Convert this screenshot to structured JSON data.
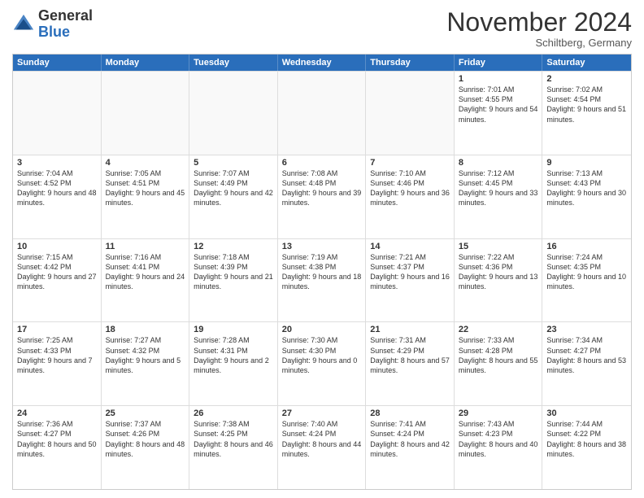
{
  "header": {
    "logo_general": "General",
    "logo_blue": "Blue",
    "month_title": "November 2024",
    "location": "Schiltberg, Germany"
  },
  "calendar": {
    "weekdays": [
      "Sunday",
      "Monday",
      "Tuesday",
      "Wednesday",
      "Thursday",
      "Friday",
      "Saturday"
    ],
    "rows": [
      [
        {
          "day": "",
          "info": "",
          "empty": true
        },
        {
          "day": "",
          "info": "",
          "empty": true
        },
        {
          "day": "",
          "info": "",
          "empty": true
        },
        {
          "day": "",
          "info": "",
          "empty": true
        },
        {
          "day": "",
          "info": "",
          "empty": true
        },
        {
          "day": "1",
          "info": "Sunrise: 7:01 AM\nSunset: 4:55 PM\nDaylight: 9 hours\nand 54 minutes."
        },
        {
          "day": "2",
          "info": "Sunrise: 7:02 AM\nSunset: 4:54 PM\nDaylight: 9 hours\nand 51 minutes."
        }
      ],
      [
        {
          "day": "3",
          "info": "Sunrise: 7:04 AM\nSunset: 4:52 PM\nDaylight: 9 hours\nand 48 minutes."
        },
        {
          "day": "4",
          "info": "Sunrise: 7:05 AM\nSunset: 4:51 PM\nDaylight: 9 hours\nand 45 minutes."
        },
        {
          "day": "5",
          "info": "Sunrise: 7:07 AM\nSunset: 4:49 PM\nDaylight: 9 hours\nand 42 minutes."
        },
        {
          "day": "6",
          "info": "Sunrise: 7:08 AM\nSunset: 4:48 PM\nDaylight: 9 hours\nand 39 minutes."
        },
        {
          "day": "7",
          "info": "Sunrise: 7:10 AM\nSunset: 4:46 PM\nDaylight: 9 hours\nand 36 minutes."
        },
        {
          "day": "8",
          "info": "Sunrise: 7:12 AM\nSunset: 4:45 PM\nDaylight: 9 hours\nand 33 minutes."
        },
        {
          "day": "9",
          "info": "Sunrise: 7:13 AM\nSunset: 4:43 PM\nDaylight: 9 hours\nand 30 minutes."
        }
      ],
      [
        {
          "day": "10",
          "info": "Sunrise: 7:15 AM\nSunset: 4:42 PM\nDaylight: 9 hours\nand 27 minutes."
        },
        {
          "day": "11",
          "info": "Sunrise: 7:16 AM\nSunset: 4:41 PM\nDaylight: 9 hours\nand 24 minutes."
        },
        {
          "day": "12",
          "info": "Sunrise: 7:18 AM\nSunset: 4:39 PM\nDaylight: 9 hours\nand 21 minutes."
        },
        {
          "day": "13",
          "info": "Sunrise: 7:19 AM\nSunset: 4:38 PM\nDaylight: 9 hours\nand 18 minutes."
        },
        {
          "day": "14",
          "info": "Sunrise: 7:21 AM\nSunset: 4:37 PM\nDaylight: 9 hours\nand 16 minutes."
        },
        {
          "day": "15",
          "info": "Sunrise: 7:22 AM\nSunset: 4:36 PM\nDaylight: 9 hours\nand 13 minutes."
        },
        {
          "day": "16",
          "info": "Sunrise: 7:24 AM\nSunset: 4:35 PM\nDaylight: 9 hours\nand 10 minutes."
        }
      ],
      [
        {
          "day": "17",
          "info": "Sunrise: 7:25 AM\nSunset: 4:33 PM\nDaylight: 9 hours\nand 7 minutes."
        },
        {
          "day": "18",
          "info": "Sunrise: 7:27 AM\nSunset: 4:32 PM\nDaylight: 9 hours\nand 5 minutes."
        },
        {
          "day": "19",
          "info": "Sunrise: 7:28 AM\nSunset: 4:31 PM\nDaylight: 9 hours\nand 2 minutes."
        },
        {
          "day": "20",
          "info": "Sunrise: 7:30 AM\nSunset: 4:30 PM\nDaylight: 9 hours\nand 0 minutes."
        },
        {
          "day": "21",
          "info": "Sunrise: 7:31 AM\nSunset: 4:29 PM\nDaylight: 8 hours\nand 57 minutes."
        },
        {
          "day": "22",
          "info": "Sunrise: 7:33 AM\nSunset: 4:28 PM\nDaylight: 8 hours\nand 55 minutes."
        },
        {
          "day": "23",
          "info": "Sunrise: 7:34 AM\nSunset: 4:27 PM\nDaylight: 8 hours\nand 53 minutes."
        }
      ],
      [
        {
          "day": "24",
          "info": "Sunrise: 7:36 AM\nSunset: 4:27 PM\nDaylight: 8 hours\nand 50 minutes."
        },
        {
          "day": "25",
          "info": "Sunrise: 7:37 AM\nSunset: 4:26 PM\nDaylight: 8 hours\nand 48 minutes."
        },
        {
          "day": "26",
          "info": "Sunrise: 7:38 AM\nSunset: 4:25 PM\nDaylight: 8 hours\nand 46 minutes."
        },
        {
          "day": "27",
          "info": "Sunrise: 7:40 AM\nSunset: 4:24 PM\nDaylight: 8 hours\nand 44 minutes."
        },
        {
          "day": "28",
          "info": "Sunrise: 7:41 AM\nSunset: 4:24 PM\nDaylight: 8 hours\nand 42 minutes."
        },
        {
          "day": "29",
          "info": "Sunrise: 7:43 AM\nSunset: 4:23 PM\nDaylight: 8 hours\nand 40 minutes."
        },
        {
          "day": "30",
          "info": "Sunrise: 7:44 AM\nSunset: 4:22 PM\nDaylight: 8 hours\nand 38 minutes."
        }
      ]
    ]
  }
}
